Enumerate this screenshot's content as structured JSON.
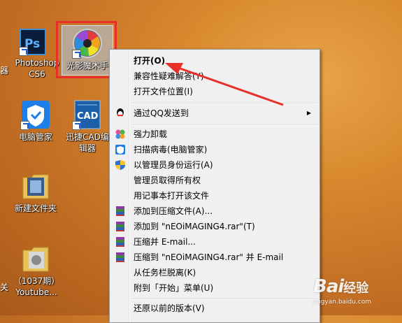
{
  "desktop": {
    "icons": [
      {
        "label": "Photoshop CS6",
        "icon": "photoshop-icon",
        "partial_left": "器"
      },
      {
        "label": "光影魔术手",
        "icon": "neoimaging-icon"
      },
      {
        "label": "电脑管家",
        "icon": "tencent-pc-manager-icon"
      },
      {
        "label": "迅捷CAD编辑器",
        "icon": "cad-editor-icon"
      },
      {
        "label": "新建文件夹",
        "icon": "folder-icon"
      },
      {
        "label": "（1037期）Youtube...",
        "icon": "folder-icon",
        "partial_left": "关"
      }
    ]
  },
  "context_menu": {
    "items": [
      {
        "label": "打开(O)",
        "bold": true
      },
      {
        "label": "兼容性疑难解答(Y)"
      },
      {
        "label": "打开文件位置(I)"
      },
      {
        "label": "通过QQ发送到",
        "icon": "qq-icon",
        "submenu": true
      },
      {
        "label": "强力卸载",
        "icon": "uninstall-icon"
      },
      {
        "label": "扫描病毒(电脑管家)",
        "icon": "shield-icon"
      },
      {
        "label": "以管理员身份运行(A)",
        "icon": "uac-shield-icon"
      },
      {
        "label": "管理员取得所有权"
      },
      {
        "label": "用记事本打开该文件"
      },
      {
        "label": "添加到压缩文件(A)...",
        "icon": "winrar-icon"
      },
      {
        "label": "添加到 \"nEOiMAGING4.rar\"(T)",
        "icon": "winrar-icon"
      },
      {
        "label": "压缩并 E-mail...",
        "icon": "winrar-icon"
      },
      {
        "label": "压缩到 \"nEOiMAGING4.rar\" 并 E-mail",
        "icon": "winrar-icon"
      },
      {
        "label": "从任务栏脱离(K)"
      },
      {
        "label": "附到「开始」菜单(U)"
      },
      {
        "label": "还原以前的版本(V)"
      }
    ]
  },
  "watermark": {
    "brand": "Bai",
    "brand2": "经验",
    "url": "jingyan.baidu.com"
  },
  "colors": {
    "highlight_border": "#e8302a",
    "arrow": "#e8302a"
  }
}
